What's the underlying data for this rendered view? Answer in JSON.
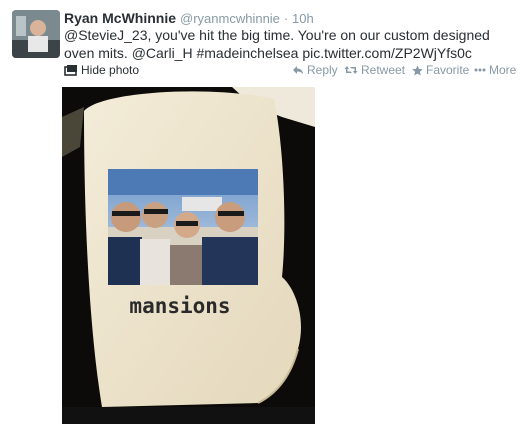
{
  "tweet": {
    "fullname": "Ryan McWhinnie",
    "username": "@ryanmcwhinnie",
    "separator": "·",
    "time": "10h",
    "text": "@StevieJ_23, you've hit the big time. You're on our custom designed oven mits. @Carli_H  #madeinchelsea pic.twitter.com/ZP2WjYfs0c"
  },
  "actions": {
    "hide_photo": "Hide photo",
    "reply": "Reply",
    "retweet": "Retweet",
    "favorite": "Favorite",
    "more": "More"
  },
  "photo": {
    "caption": "mansions"
  },
  "colors": {
    "text": "#292f33",
    "muted": "#8899a6",
    "link": "#0084b4"
  }
}
